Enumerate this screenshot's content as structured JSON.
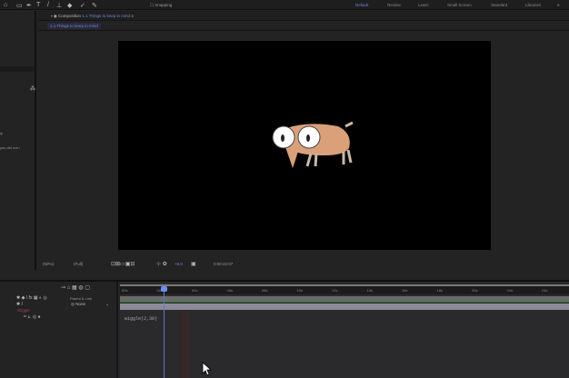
{
  "toolbar": {
    "tools": [
      "hand-tool",
      "zoom-tool",
      "rectangle-tool",
      "pen-tool",
      "type-tool",
      "brush-tool",
      "clone-stamp-tool",
      "eraser-tool",
      "roto-brush-tool",
      "puppet-tool"
    ],
    "snapping_label": "Snapping"
  },
  "workspaces": [
    "Default",
    "Review",
    "Learn",
    "Small Screen",
    "Standard",
    "Libraries"
  ],
  "composition": {
    "panel_label": "Composition",
    "comp_name": "1.1 Things to keep in mind",
    "tab_label": "1.1 Things to keep in mind"
  },
  "left_panel": {
    "text_fragments": [
      "ly",
      "you did not i"
    ]
  },
  "viewer_controls": {
    "zoom": "(50%)",
    "resolution": "(Full)",
    "exposure": "+0.0",
    "timecode": "0:00:22:07"
  },
  "timeline": {
    "column_header": "Parent & Link",
    "parent_value": "None",
    "layer_name": "Wiggle",
    "expression": "wiggle(2,30)",
    "ruler_ticks": [
      "00s",
      "02s",
      "04s",
      "06s",
      "08s",
      "10s",
      "12s",
      "14s",
      "16s",
      "18s",
      "20s",
      "22s",
      "24s"
    ]
  },
  "colors": {
    "accent": "#6c8ff0",
    "viewer_bg": "#000000",
    "creature_body": "#d9a07a",
    "work_area": "#1c7a1c"
  }
}
